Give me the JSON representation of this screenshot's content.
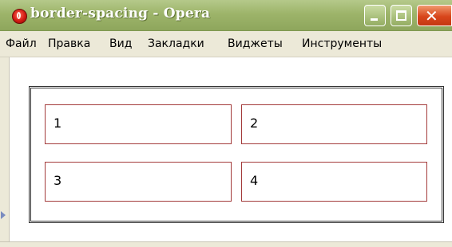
{
  "window": {
    "title": "border-spacing - Opera",
    "controls": {
      "minimize": "_",
      "maximize": "□",
      "close": "✕"
    }
  },
  "menubar": {
    "items": [
      "Файл",
      "Правка",
      "Вид",
      "Закладки",
      "Виджеты",
      "Инструменты"
    ]
  },
  "table": {
    "cells": [
      "1",
      "2",
      "3",
      "4"
    ]
  },
  "colors": {
    "titlebar": "#9db46a",
    "cell_border": "#a33a3a",
    "table_border": "#333333"
  }
}
